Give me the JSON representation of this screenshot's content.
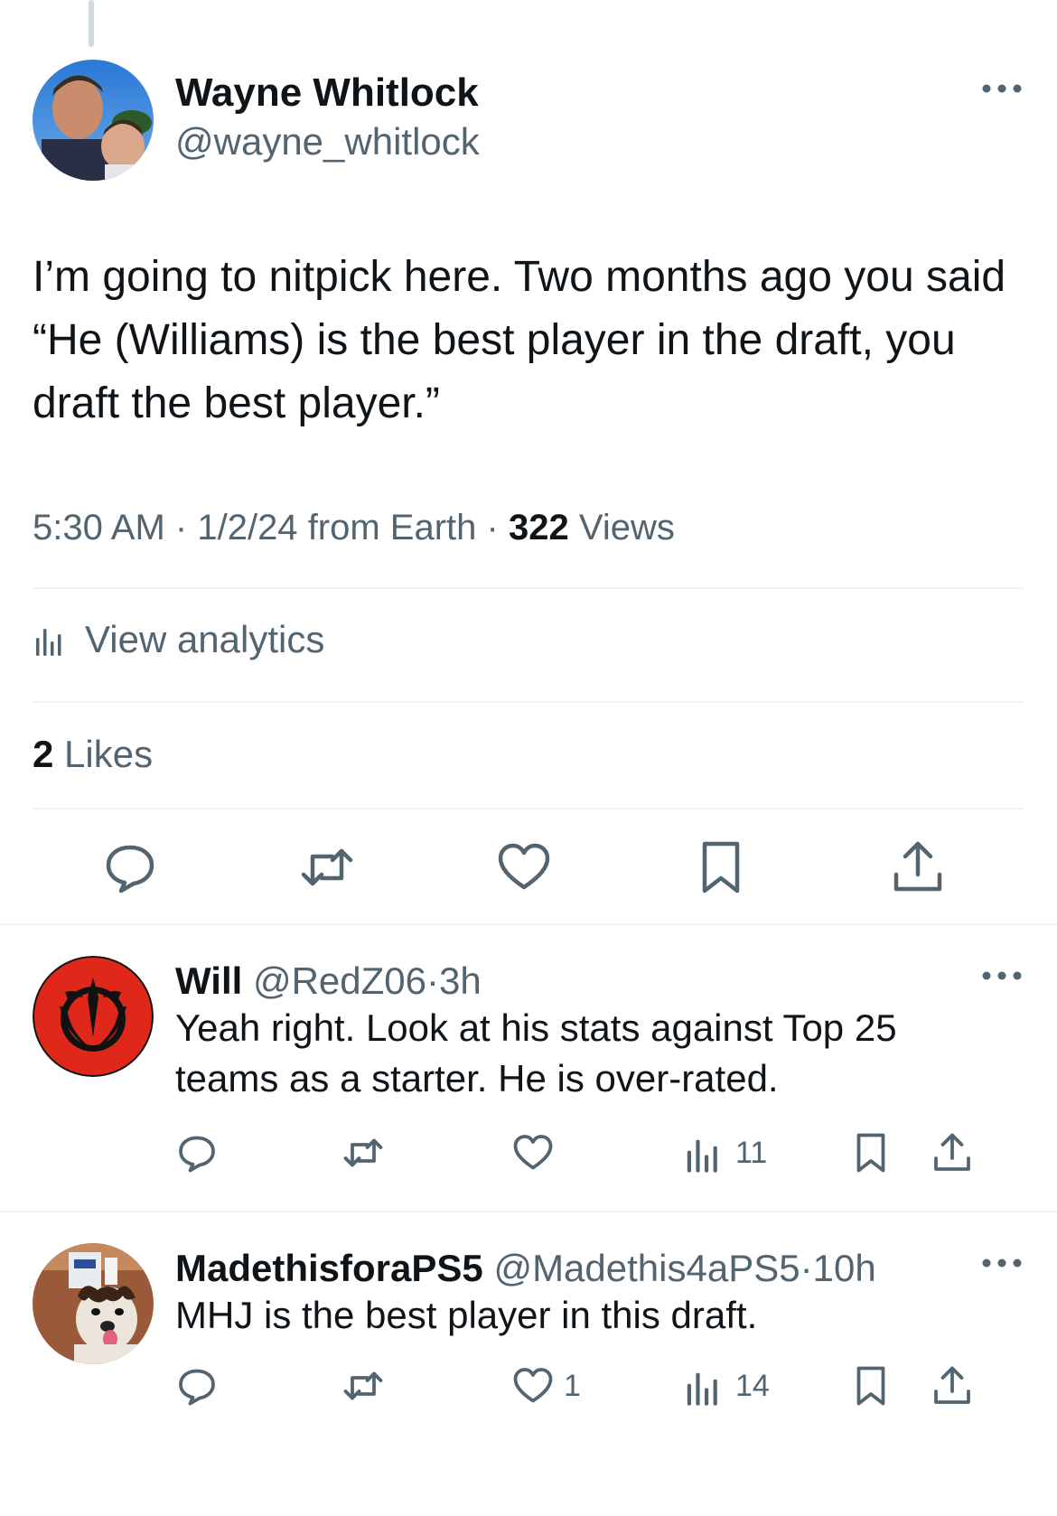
{
  "main_tweet": {
    "author_name": "Wayne Whitlock",
    "author_handle": "@wayne_whitlock",
    "text": "I’m going to nitpick here. Two months ago you said “He (Williams) is the best player in the draft, you draft the best player.”",
    "time": "5:30 AM",
    "date": "1/2/24",
    "source": "from Earth",
    "views_count": "322",
    "views_label": "Views",
    "analytics_label": "View analytics",
    "likes_count": "2",
    "likes_label": "Likes"
  },
  "replies": [
    {
      "name": "Will",
      "handle": "@RedZ06",
      "time": "3h",
      "text": "Yeah right. Look at his stats against Top 25 teams as a starter. He is over-rated.",
      "likes": "",
      "views": "11"
    },
    {
      "name": "MadethisforaPS5",
      "handle": "@Madethis4aPS5",
      "time": "10h",
      "text": "MHJ is the best player in this draft.",
      "likes": "1",
      "views": "14"
    }
  ],
  "separator": "·",
  "icons": [
    "more-icon",
    "analytics-icon",
    "reply-icon",
    "retweet-icon",
    "like-icon",
    "bookmark-icon",
    "share-icon",
    "views-icon"
  ],
  "colors": {
    "text": "#0f1419",
    "secondary": "#536471",
    "divider": "#eff3f4",
    "rebel_red": "#e0281a"
  }
}
